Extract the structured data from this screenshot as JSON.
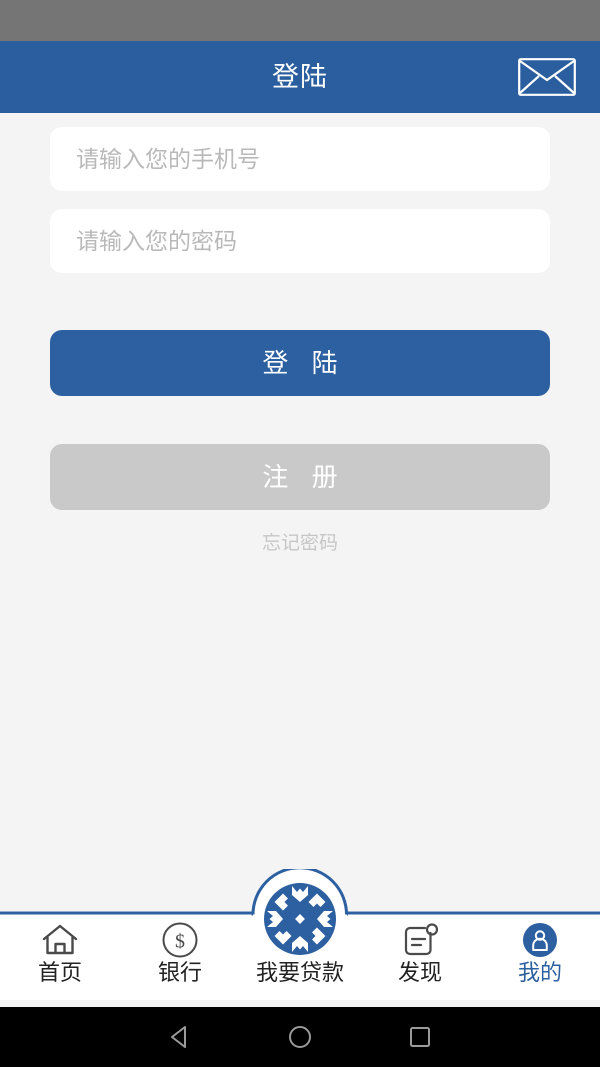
{
  "status_bar": {
    "background": "#757575"
  },
  "header": {
    "title": "登陆",
    "background": "#2b5e9e",
    "mail_icon": "envelope-icon"
  },
  "form": {
    "phone": {
      "value": "",
      "placeholder": "请输入您的手机号"
    },
    "password": {
      "value": "",
      "placeholder": "请输入您的密码"
    },
    "login_label": "登 陆",
    "register_label": "注 册",
    "forgot_label": "忘记密码",
    "login_color": "#2d60a0",
    "register_color": "#c9c9c9"
  },
  "tabbar": {
    "accent": "#2d60a0",
    "items": [
      {
        "label": "首页",
        "icon": "home-icon",
        "active": false
      },
      {
        "label": "银行",
        "icon": "dollar-circle-icon",
        "active": false
      },
      {
        "label": "我要贷款",
        "icon": "loan-badge-icon",
        "active": false
      },
      {
        "label": "发现",
        "icon": "discover-document-icon",
        "active": false
      },
      {
        "label": "我的",
        "icon": "user-circle-icon",
        "active": true
      }
    ]
  },
  "android_nav": {
    "back": "back-triangle-icon",
    "home": "home-circle-icon",
    "recents": "recents-square-icon"
  }
}
